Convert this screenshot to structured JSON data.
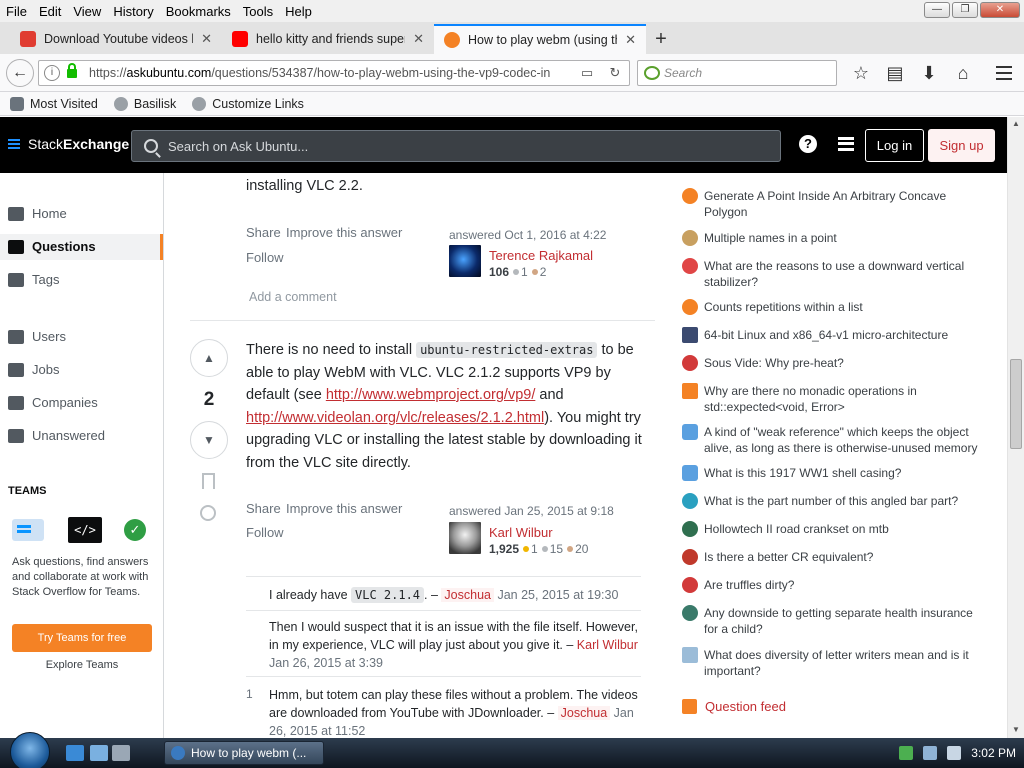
{
  "browser": {
    "menu": [
      "File",
      "Edit",
      "View",
      "History",
      "Bookmarks",
      "Tools",
      "Help"
    ],
    "tabs": [
      {
        "title": "Download Youtube videos h",
        "icon_color": "#e03c31"
      },
      {
        "title": "hello kitty and friends super",
        "icon_color": "#ff0000"
      },
      {
        "title": "How to play webm (using th",
        "icon_color": "#f48225"
      }
    ],
    "url_domain": "askubuntu.com",
    "url_prefix": "https://",
    "url_rest": "/questions/534387/how-to-play-webm-using-the-vp9-codec-in",
    "search_placeholder": "Search",
    "bookmarks": [
      "Most Visited",
      "Basilisk",
      "Customize Links"
    ]
  },
  "topbar": {
    "brand_a": "Stack",
    "brand_b": "Exchange",
    "search_placeholder": "Search on Ask Ubuntu...",
    "help": "?",
    "login": "Log in",
    "signup": "Sign up"
  },
  "leftnav": {
    "items": [
      "Home",
      "Questions",
      "Tags",
      "Users",
      "Jobs",
      "Companies",
      "Unanswered"
    ],
    "teams_heading": "TEAMS",
    "teams_text": "Ask questions, find answers and collaborate at work with Stack Overflow for Teams.",
    "teams_button": "Try Teams for free",
    "teams_explore": "Explore Teams",
    "code_glyph": "</>",
    "check_glyph": "✓"
  },
  "answer_prev": {
    "tail_text": "installing VLC 2.2.",
    "share": "Share",
    "improve": "Improve this answer",
    "follow": "Follow",
    "answered": "answered Oct 1, 2016 at 4:22",
    "user": "Terence Rajkamal",
    "rep": "106",
    "silver": "1",
    "bronze": "2",
    "add_comment": "Add a comment"
  },
  "answer": {
    "score": "2",
    "text_1": "There is no need to install ",
    "code": "ubuntu-restricted-extras",
    "text_2": " to be able to play WebM with VLC. VLC 2.1.2 supports VP9 by default (see ",
    "link1": "http://www.webmproject.org/vp9/",
    "text_3": " and ",
    "link2": "http://www.videolan.org/vlc/releases/2.1.2.html",
    "text_4": "). You might try upgrading VLC or installing the latest stable by downloading it from the VLC site directly.",
    "share": "Share",
    "improve": "Improve this answer",
    "follow": "Follow",
    "answered": "answered Jan 25, 2015 at 9:18",
    "user": "Karl Wilbur",
    "rep": "1,925",
    "gold": "1",
    "silver": "15",
    "bronze": "20"
  },
  "comments": [
    {
      "pre": "I already have ",
      "code": "VLC 2.1.4",
      "post": ". –",
      "user": "Joschua",
      "date": "Jan 25, 2015 at 19:30",
      "score": ""
    },
    {
      "text": "Then I would suspect that it is an issue with the file itself. However, in my experience, VLC will play just about you give it.",
      "user": "Karl Wilbur",
      "date": "Jan 26, 2015 at 3:39",
      "score": ""
    },
    {
      "text": "Hmm, but totem can play these files without a problem. The videos are downloaded from YouTube with JDownloader.",
      "user": "Joschua",
      "date": "Jan 26, 2015 at 11:52",
      "score": "1"
    }
  ],
  "hot_questions": [
    {
      "title": "Generate A Point Inside An Arbitrary Concave Polygon",
      "icon_color": "#f48225"
    },
    {
      "title": "Multiple names in a point",
      "icon_color": "#c8a060"
    },
    {
      "title": "What are the reasons to use a downward vertical stabilizer?",
      "icon_color": "#e04646"
    },
    {
      "title": "Counts repetitions within a list",
      "icon_color": "#f48225"
    },
    {
      "title": "64-bit Linux and x86_64-v1 micro-architecture",
      "icon_color": "#3b4a70"
    },
    {
      "title": "Sous Vide: Why pre-heat?",
      "icon_color": "#d23a3a"
    },
    {
      "title": "Why are there no monadic operations in std::expected<void, Error>",
      "icon_color": "#f48225"
    },
    {
      "title": "A kind of \"weak reference\" which keeps the object alive, as long as there is otherwise-unused memory",
      "icon_color": "#5aa0e0"
    },
    {
      "title": "What is this 1917 WW1 shell casing?",
      "icon_color": "#5aa0e0"
    },
    {
      "title": "What is the part number of this angled bar part?",
      "icon_color": "#2aa0c0"
    },
    {
      "title": "Hollowtech II road crankset on mtb",
      "icon_color": "#2f6f4f"
    },
    {
      "title": "Is there a better CR equivalent?",
      "icon_color": "#c0392b"
    },
    {
      "title": "Are truffles dirty?",
      "icon_color": "#d23a3a"
    },
    {
      "title": "Any downside to getting separate health insurance for a child?",
      "icon_color": "#3a7a6a"
    },
    {
      "title": "What does diversity of letter writers mean and is it important?",
      "icon_color": "#9bbcd8"
    }
  ],
  "question_feed": "Question feed",
  "taskbar": {
    "task_title": "How to play webm (...",
    "clock": "3:02 PM"
  }
}
